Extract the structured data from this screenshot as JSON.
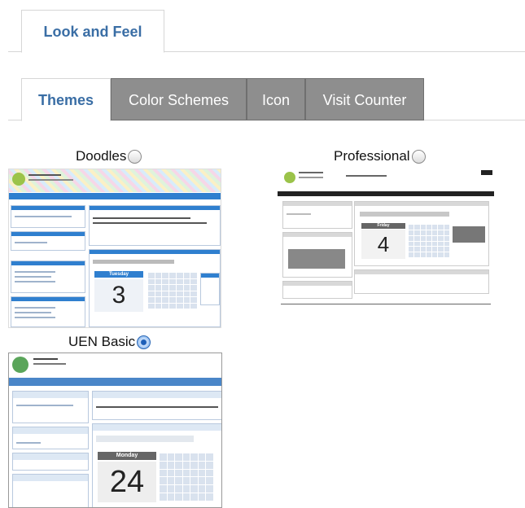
{
  "header": {
    "tab_label": "Look and Feel"
  },
  "subtabs": [
    {
      "label": "Themes",
      "active": true
    },
    {
      "label": "Color Schemes",
      "active": false
    },
    {
      "label": "Icon",
      "active": false
    },
    {
      "label": "Visit Counter",
      "active": false
    }
  ],
  "themes": [
    {
      "name": "Doodles",
      "selected": false,
      "preview_day": "Tuesday",
      "preview_date": "3"
    },
    {
      "name": "Professional",
      "selected": false,
      "preview_day": "Friday",
      "preview_date": "4"
    },
    {
      "name": "UEN Basic",
      "selected": true,
      "preview_day": "Monday",
      "preview_date": "24"
    }
  ],
  "colors": {
    "accent_text": "#3a6ea5",
    "inactive_tab": "#8e8e8e",
    "doodles_bar": "#2f7fcf",
    "professional_dark": "#222222",
    "uen_blue": "#4a86c8"
  }
}
